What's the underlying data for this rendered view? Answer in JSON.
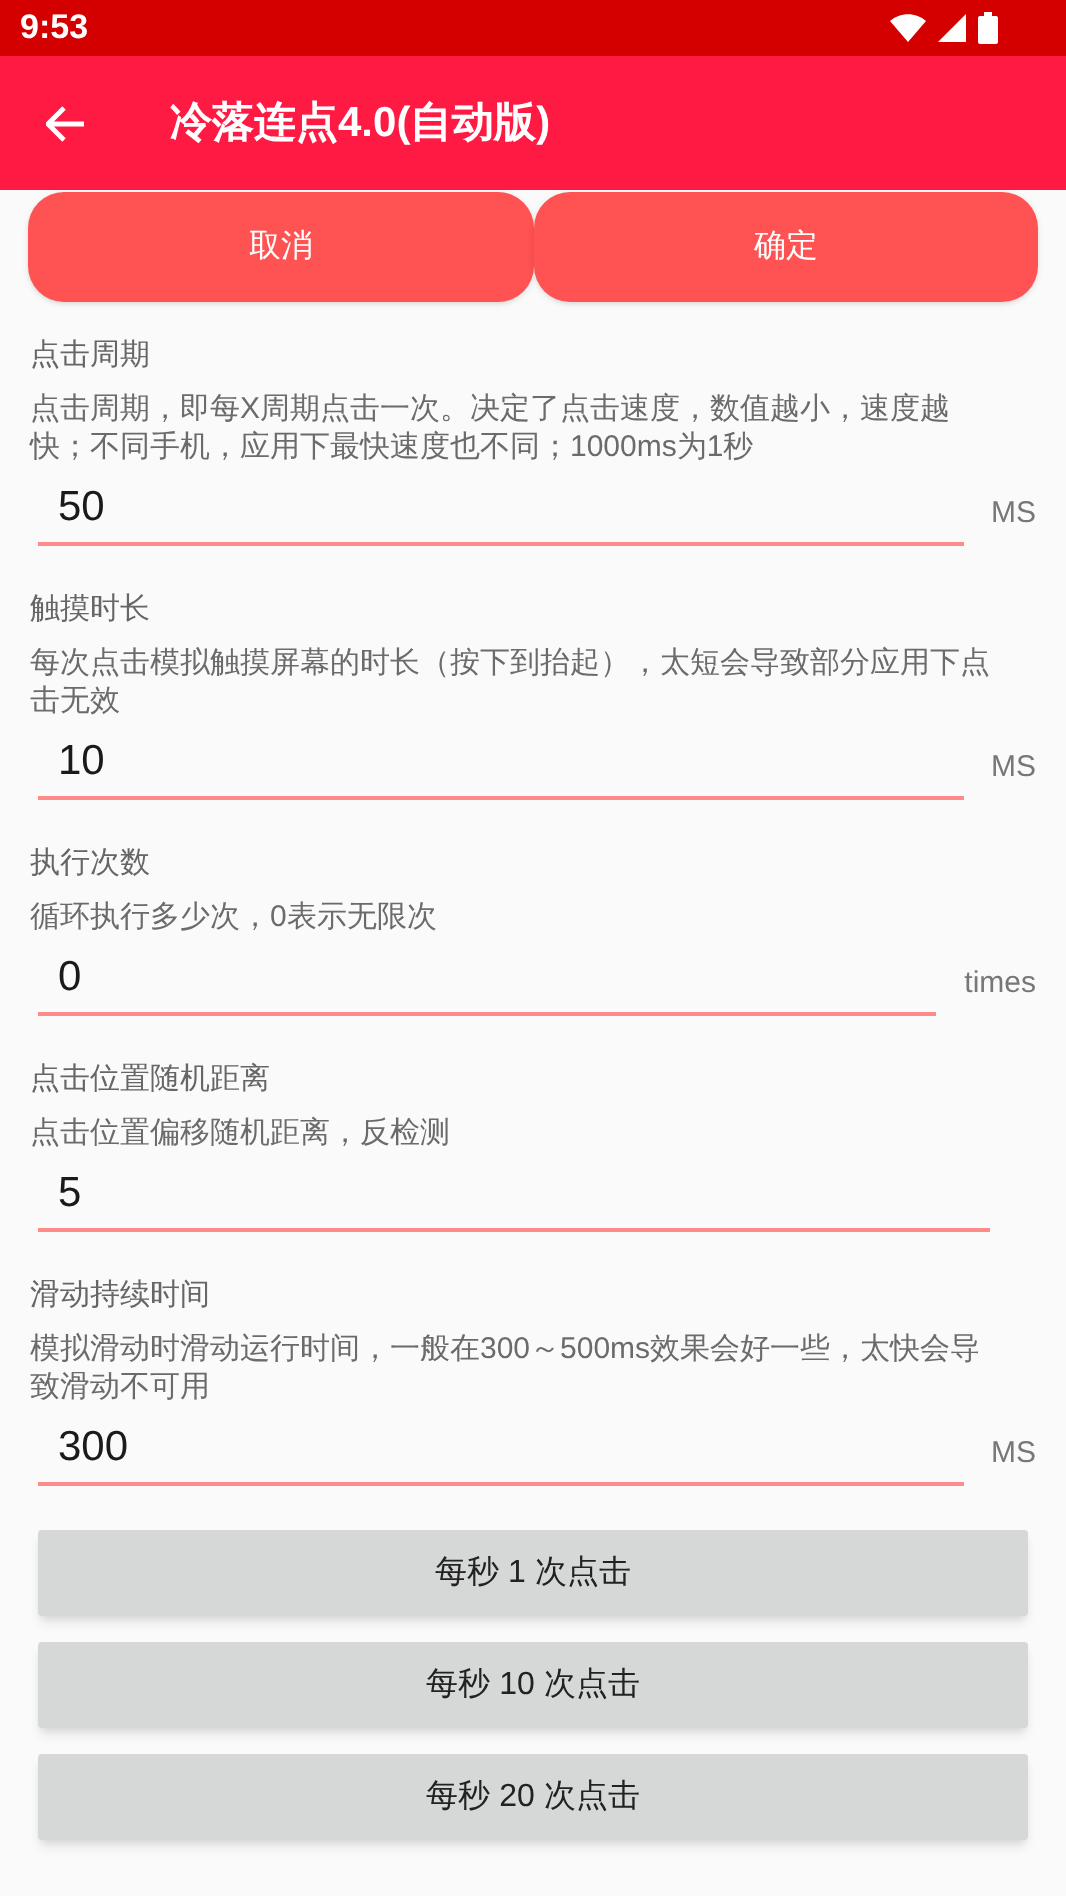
{
  "status_bar": {
    "time": "9:53"
  },
  "app_bar": {
    "title": "冷落连点4.0(自动版)"
  },
  "actions": [
    "取消",
    "确定"
  ],
  "settings": [
    {
      "label": "点击周期",
      "description": "点击周期，即每X周期点击一次。决定了点击速度，数值越小，速度越快；不同手机，应用下最快速度也不同；1000ms为1秒",
      "value": "50",
      "unit": "MS"
    },
    {
      "label": "触摸时长",
      "description": "每次点击模拟触摸屏幕的时长（按下到抬起），太短会导致部分应用下点击无效",
      "value": "10",
      "unit": "MS"
    },
    {
      "label": "执行次数",
      "description": "循环执行多少次，0表示无限次",
      "value": "0",
      "unit": "times"
    },
    {
      "label": "点击位置随机距离",
      "description": "点击位置偏移随机距离，反检测",
      "value": "5"
    },
    {
      "label": "滑动持续时间",
      "description": "模拟滑动时滑动运行时间，一般在300～500ms效果会好一些，太快会导致滑动不可用",
      "value": "300",
      "unit": "MS"
    }
  ],
  "presets": [
    "每秒 1 次点击",
    "每秒 10 次点击",
    "每秒 20 次点击"
  ]
}
